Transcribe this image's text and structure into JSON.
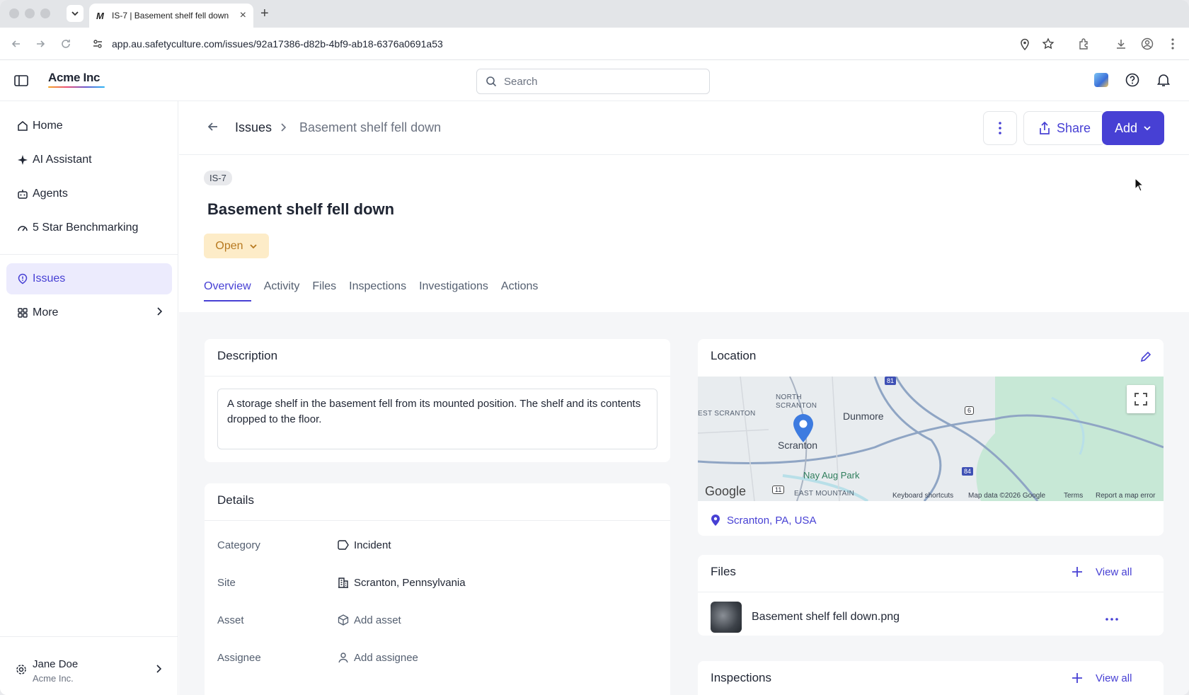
{
  "browser": {
    "tab_title": "IS-7 | Basement shelf fell down",
    "tab_favicon": "M",
    "url": "app.au.safetyculture.com/issues/92a17386-d82b-4bf9-ab18-6376a0691a53"
  },
  "header": {
    "brand": "Acme Inc",
    "search_placeholder": "Search"
  },
  "sidebar": {
    "items": [
      {
        "label": "Home",
        "icon": "home-icon"
      },
      {
        "label": "AI Assistant",
        "icon": "sparkle-icon"
      },
      {
        "label": "Agents",
        "icon": "robot-icon"
      },
      {
        "label": "5 Star Benchmarking",
        "icon": "gauge-icon"
      },
      {
        "label": "Issues",
        "icon": "issue-icon"
      },
      {
        "label": "More",
        "icon": "grid-icon"
      }
    ],
    "user": {
      "name": "Jane Doe",
      "org": "Acme Inc."
    }
  },
  "page": {
    "breadcrumb_parent": "Issues",
    "breadcrumb_current": "Basement shelf fell down",
    "share_label": "Share",
    "add_label": "Add",
    "issue_id": "IS-7",
    "title": "Basement shelf fell down",
    "status": "Open",
    "tabs": [
      "Overview",
      "Activity",
      "Files",
      "Inspections",
      "Investigations",
      "Actions"
    ],
    "active_tab": "Overview"
  },
  "description": {
    "title": "Description",
    "text": "A storage shelf in the basement fell from its mounted position. The shelf and its contents dropped to the floor."
  },
  "details": {
    "title": "Details",
    "rows": [
      {
        "label": "Category",
        "value": "Incident",
        "icon": "tag-icon"
      },
      {
        "label": "Site",
        "value": "Scranton, Pennsylvania",
        "icon": "building-icon"
      },
      {
        "label": "Asset",
        "value": "Add asset",
        "icon": "box-icon"
      },
      {
        "label": "Assignee",
        "value": "Add assignee",
        "icon": "user-icon"
      }
    ]
  },
  "location": {
    "title": "Location",
    "address": "Scranton, PA, USA",
    "map_labels": {
      "scranton": "Scranton",
      "dunmore": "Dunmore",
      "north_scranton": "NORTH\nSCRANTON",
      "east_scranton": "EST SCRANTON",
      "nay_aug": "Nay Aug Park",
      "east_mountain": "EAST MOUNTAIN",
      "google": "Google"
    },
    "map_footer": [
      "Keyboard shortcuts",
      "Map data ©2026 Google",
      "Terms",
      "Report a map error"
    ],
    "highway_shields": [
      "81",
      "6",
      "84",
      "11"
    ]
  },
  "files": {
    "title": "Files",
    "view_all": "View all",
    "items": [
      {
        "name": "Basement shelf fell down.png"
      }
    ]
  },
  "inspections": {
    "title": "Inspections",
    "view_all": "View all"
  }
}
